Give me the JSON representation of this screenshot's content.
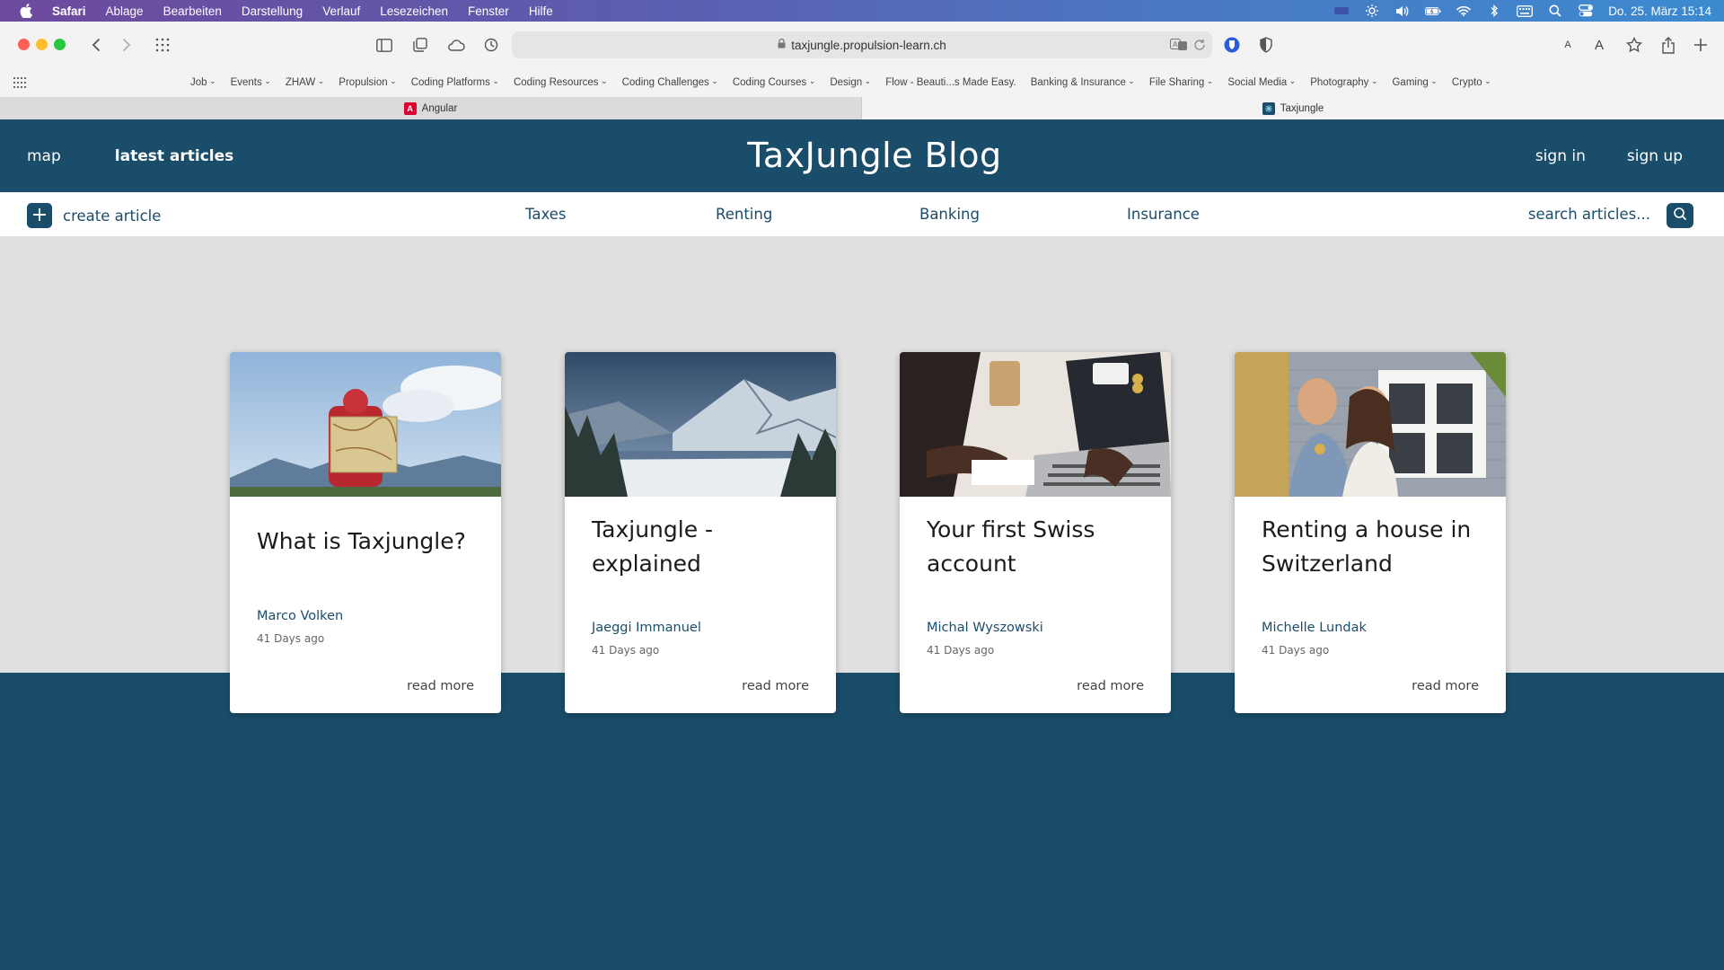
{
  "menubar": {
    "app_name": "Safari",
    "items": [
      "Ablage",
      "Bearbeiten",
      "Darstellung",
      "Verlauf",
      "Lesezeichen",
      "Fenster",
      "Hilfe"
    ],
    "clock": "Do. 25. März  15:14"
  },
  "browser": {
    "url": "taxjungle.propulsion-learn.ch",
    "bookmarks": [
      "Job",
      "Events",
      "ZHAW",
      "Propulsion",
      "Coding Platforms",
      "Coding Resources",
      "Coding Challenges",
      "Coding Courses",
      "Design",
      "Flow - Beauti...s Made Easy.",
      "Banking & Insurance",
      "File Sharing",
      "Social Media",
      "Photography",
      "Gaming",
      "Crypto"
    ],
    "tabs": [
      {
        "label": "Angular",
        "active": false
      },
      {
        "label": "Taxjungle",
        "active": true
      }
    ]
  },
  "site": {
    "title": "TaxJungle Blog",
    "nav_left": [
      "map",
      "latest articles"
    ],
    "nav_right": [
      "sign in",
      "sign up"
    ],
    "create_label": "create article",
    "categories": [
      "Taxes",
      "Renting",
      "Banking",
      "Insurance"
    ],
    "search_placeholder": "search articles..."
  },
  "articles": [
    {
      "title": "What is Taxjungle?",
      "author": "Marco Volken",
      "date": "41 Days ago",
      "cta": "read more"
    },
    {
      "title": "Taxjungle - explained",
      "author": "Jaeggi Immanuel",
      "date": "41 Days ago",
      "cta": "read more"
    },
    {
      "title": "Your first Swiss account",
      "author": "Michal Wyszowski",
      "date": "41 Days ago",
      "cta": "read more"
    },
    {
      "title": "Renting a house in Switzerland",
      "author": "Michelle Lundak",
      "date": "41 Days ago",
      "cta": "read more"
    }
  ],
  "colors": {
    "brand": "#1a4d6a",
    "content_bg": "#e0e0e0",
    "card_bg": "#ffffff"
  },
  "icons": [
    "apple-icon",
    "brightness-icon",
    "volume-icon",
    "battery-icon",
    "wifi-icon",
    "bluetooth-icon",
    "keyboard-icon",
    "search-icon",
    "control-center-icon",
    "sidebar-icon",
    "tabs-overview-icon",
    "icloud-icon",
    "history-icon",
    "translate-icon",
    "reload-icon",
    "bitwarden-icon",
    "privacy-shield-icon",
    "text-smaller-icon",
    "text-larger-icon",
    "bookmark-star-icon",
    "share-icon",
    "new-tab-icon",
    "plus-icon",
    "search-icon"
  ]
}
